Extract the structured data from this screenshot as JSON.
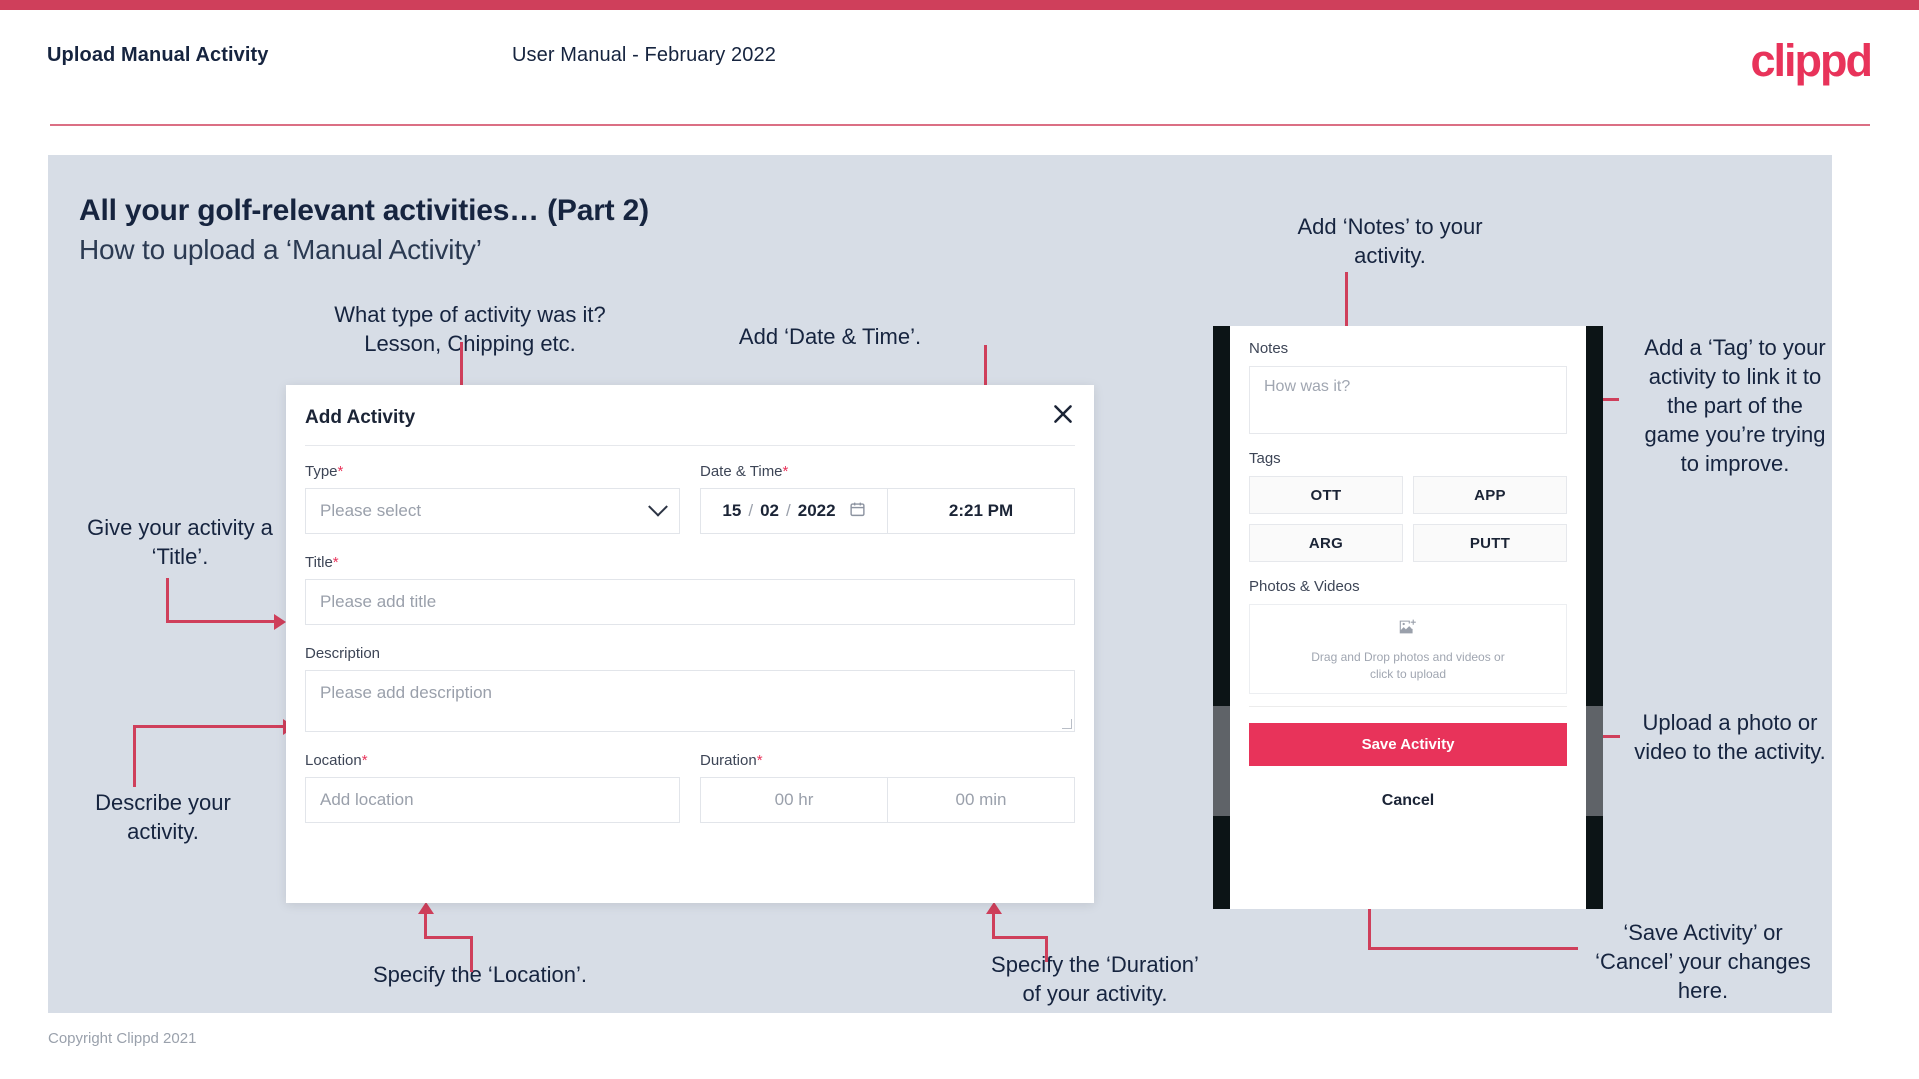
{
  "header": {
    "left_title": "Upload Manual Activity",
    "center_title": "User Manual - February 2022",
    "logo": "clippd"
  },
  "slide": {
    "title": "All your golf-relevant activities… (Part 2)",
    "subtitle": "How to upload a ‘Manual Activity’"
  },
  "footer": {
    "copyright": "Copyright Clippd 2021"
  },
  "dialog": {
    "title": "Add Activity",
    "close_icon": "close-icon",
    "type": {
      "label": "Type",
      "required": "*",
      "placeholder": "Please select",
      "chevron": "chevron-down-icon"
    },
    "datetime": {
      "label": "Date & Time",
      "required": "*",
      "day": "15",
      "month": "02",
      "year": "2022",
      "sep": "/",
      "calendar_icon": "calendar-icon",
      "time": "2:21 PM"
    },
    "title_field": {
      "label": "Title",
      "required": "*",
      "placeholder": "Please add title"
    },
    "description": {
      "label": "Description",
      "placeholder": "Please add description"
    },
    "location": {
      "label": "Location",
      "required": "*",
      "placeholder": "Add location"
    },
    "duration": {
      "label": "Duration",
      "required": "*",
      "hours": "00 hr",
      "minutes": "00 min"
    }
  },
  "phone": {
    "notes": {
      "label": "Notes",
      "placeholder": "How was it?"
    },
    "tags": {
      "label": "Tags",
      "items": [
        "OTT",
        "APP",
        "ARG",
        "PUTT"
      ]
    },
    "photos": {
      "label": "Photos & Videos",
      "icon": "add-image-icon",
      "drop_text": "Drag and Drop photos and videos or\nclick to upload"
    },
    "save_label": "Save Activity",
    "cancel_label": "Cancel"
  },
  "annotations": {
    "type": "What type of activity was it?\nLesson, Chipping etc.",
    "datetime": "Add ‘Date & Time’.",
    "title": "Give your activity a\n‘Title’.",
    "description": "Describe your\nactivity.",
    "location": "Specify the ‘Location’.",
    "duration": "Specify the ‘Duration’\nof your activity.",
    "notes": "Add ‘Notes’ to your\nactivity.",
    "tags": "Add a ‘Tag’ to your\nactivity to link it to\nthe part of the\ngame you’re trying\nto improve.",
    "upload": "Upload a photo or\nvideo to the activity.",
    "save": "‘Save Activity’ or\n‘Cancel’ your changes\nhere."
  },
  "colors": {
    "brand": "#e8335a",
    "accent_bar": "#cf3f5b",
    "slide_bg": "#d7dde6",
    "text_dark": "#16243f"
  }
}
